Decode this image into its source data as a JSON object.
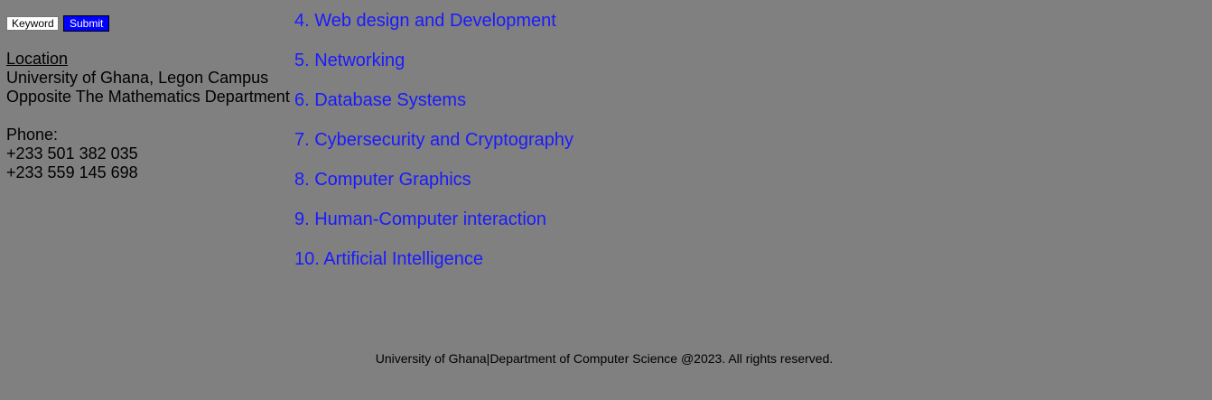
{
  "search": {
    "placeholder": "Keyword",
    "submit_label": "Submit"
  },
  "contact": {
    "location_heading": "Location",
    "location_line_1": "University of Ghana, Legon Campus",
    "location_line_2": "Opposite The Mathematics Department",
    "phone_heading": "Phone:",
    "phone_1": "+233 501 382 035",
    "phone_2": "+233 559 145 698"
  },
  "courses": [
    "4. Web design and Development",
    "5. Networking",
    "6. Database Systems",
    "7. Cybersecurity and Cryptography",
    "8. Computer Graphics",
    "9. Human-Computer interaction",
    "10. Artificial Intelligence"
  ],
  "footer": {
    "text": "University of Ghana|Department of Computer Science @2023. All rights reserved."
  },
  "colors": {
    "background": "#808080",
    "link": "#1a1aff",
    "submit_bg": "#0000ff"
  }
}
